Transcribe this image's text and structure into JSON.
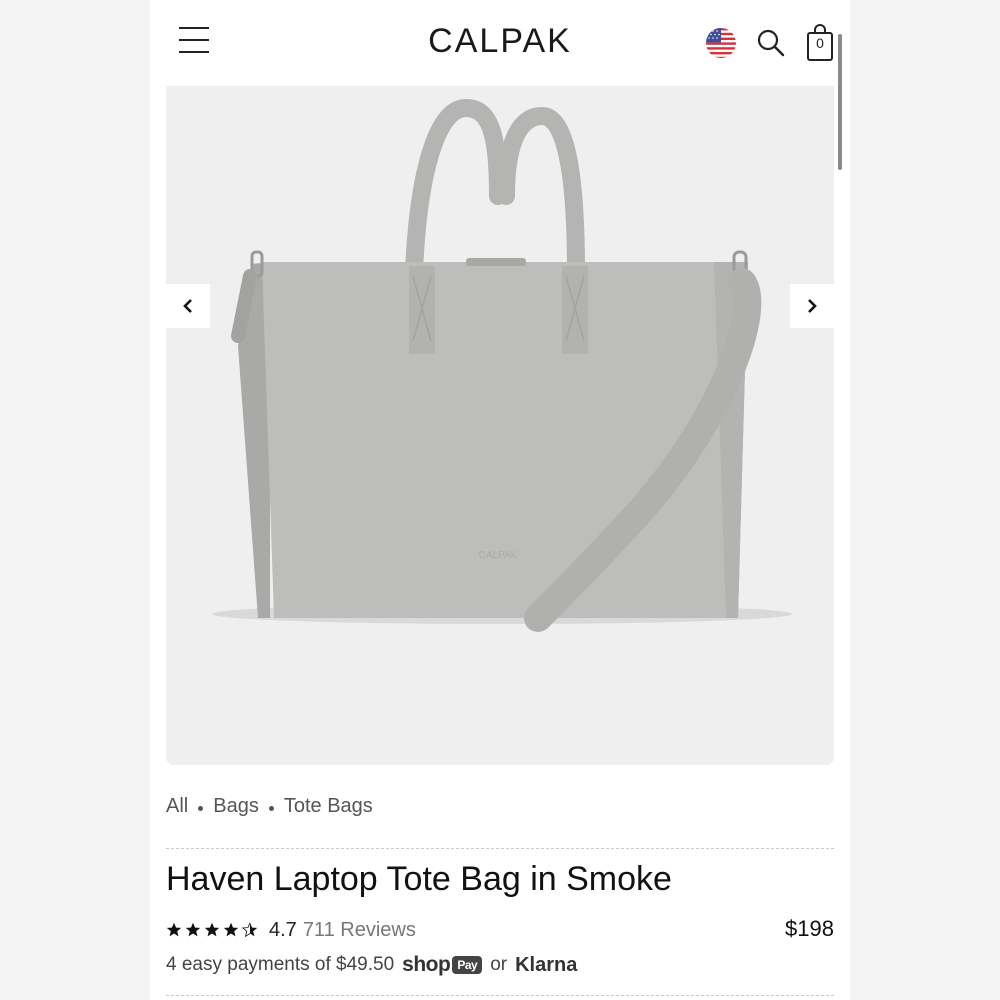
{
  "header": {
    "logo": "CALPAK",
    "menu_icon": "hamburger-menu-icon",
    "flag_icon": "us-flag-icon",
    "search_icon": "search-icon",
    "cart_icon": "shopping-bag-icon",
    "cart_count": "0"
  },
  "gallery": {
    "prev_icon": "chevron-left-icon",
    "next_icon": "chevron-right-icon",
    "image_logo_text": "CALPAK"
  },
  "breadcrumb": {
    "items": [
      "All",
      "Bags",
      "Tote Bags"
    ]
  },
  "product": {
    "title": "Haven Laptop Tote Bag in Smoke",
    "rating_value": "4.7",
    "rating_stars": 4.5,
    "reviews": "711 Reviews",
    "price": "$198",
    "installments_text": "4 easy payments of $49.50",
    "shop_text": "shop",
    "pay_text": "Pay",
    "or_text": "or",
    "klarna_text": "Klarna"
  },
  "colors": {
    "bag": "#bdbebc",
    "background": "#efefef",
    "text": "#111111"
  }
}
